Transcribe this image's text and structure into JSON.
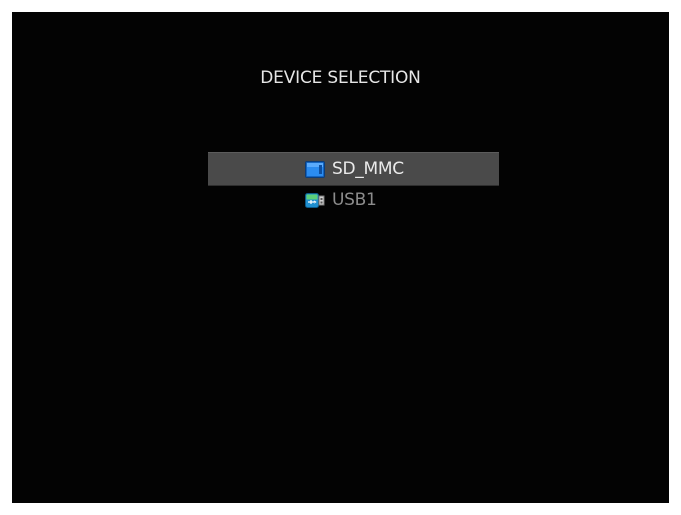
{
  "screen": {
    "title": "DEVICE SELECTION"
  },
  "devices": [
    {
      "label": "SD_MMC",
      "icon": "sd-card-icon",
      "selected": true
    },
    {
      "label": "USB1",
      "icon": "usb-drive-icon",
      "selected": false
    }
  ],
  "colors": {
    "background": "#030303",
    "selection_bar": "#4a4a4a",
    "text_active": "#eaeaea",
    "text_inactive": "#8c8c8c",
    "icon_blue": "#1a7bd6",
    "icon_green": "#3fb34a"
  }
}
